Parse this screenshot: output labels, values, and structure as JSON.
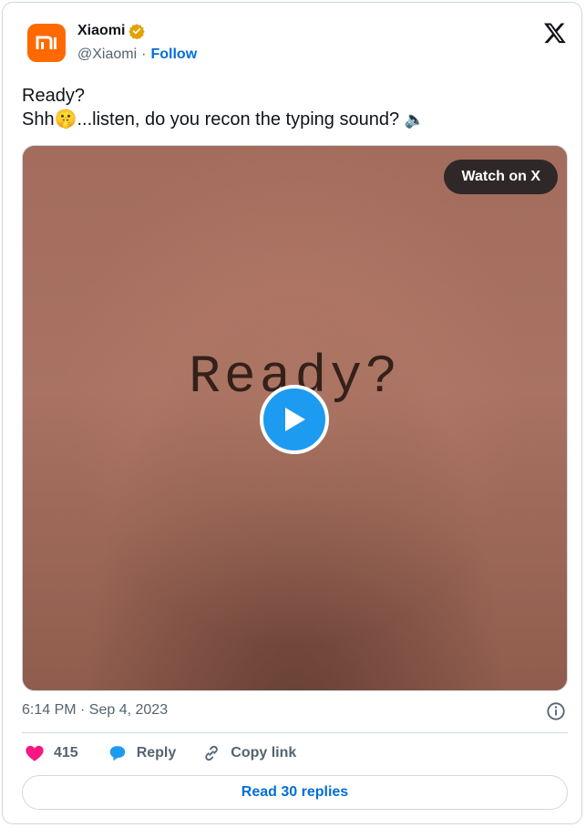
{
  "header": {
    "name": "Xiaomi",
    "handle": "@Xiaomi",
    "separator": "·",
    "follow_label": "Follow",
    "avatar_text": "mi",
    "brand_color": "#ff6900",
    "verified_color": "#e2a300"
  },
  "tweet": {
    "line1": "Ready?",
    "line2_prefix": "Shh",
    "line2_emoji": "🤫",
    "line2_suffix": "...listen, do you recon the typing sound?",
    "line2_end_emoji": "🔈"
  },
  "media": {
    "word": "Ready?",
    "watch_label": "Watch on X",
    "play_icon": "play-icon"
  },
  "meta": {
    "timestamp": "6:14 PM · Sep 4, 2023"
  },
  "actions": {
    "likes_count": "415",
    "reply_label": "Reply",
    "copy_label": "Copy link",
    "like_color": "#f91880",
    "reply_color": "#1d9bf0"
  },
  "footer": {
    "read_replies_label": "Read 30 replies"
  }
}
